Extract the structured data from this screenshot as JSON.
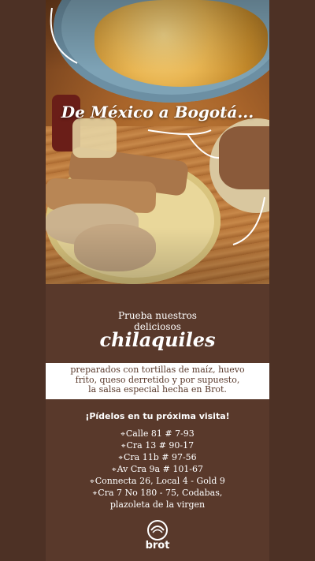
{
  "headline": "De México a Bogotá...",
  "intro_line1": "Prueba nuestros",
  "intro_line2": "deliciosos",
  "dish": "chilaquiles",
  "description": [
    "preparados con tortillas de maíz, huevo",
    "frito, queso derretido y por supuesto,",
    "la salsa especial hecha en Brot."
  ],
  "cta": "¡Pídelos en tu próxima visita!",
  "pin_icon": "location-pin-icon",
  "addresses": [
    "Calle 81 # 7-93",
    "Cra 13 # 90-17",
    "Cra 11b # 97-56",
    "Av Cra 9a # 101-67",
    "Connecta 26, Local 4 - Gold 9",
    "Cra 7 No 180 - 75, Codabas,"
  ],
  "address_tail": "plazoleta de la virgen",
  "brand": "brot",
  "colors": {
    "background": "#59392b",
    "text": "#ffffff",
    "band": "#ffffff"
  }
}
